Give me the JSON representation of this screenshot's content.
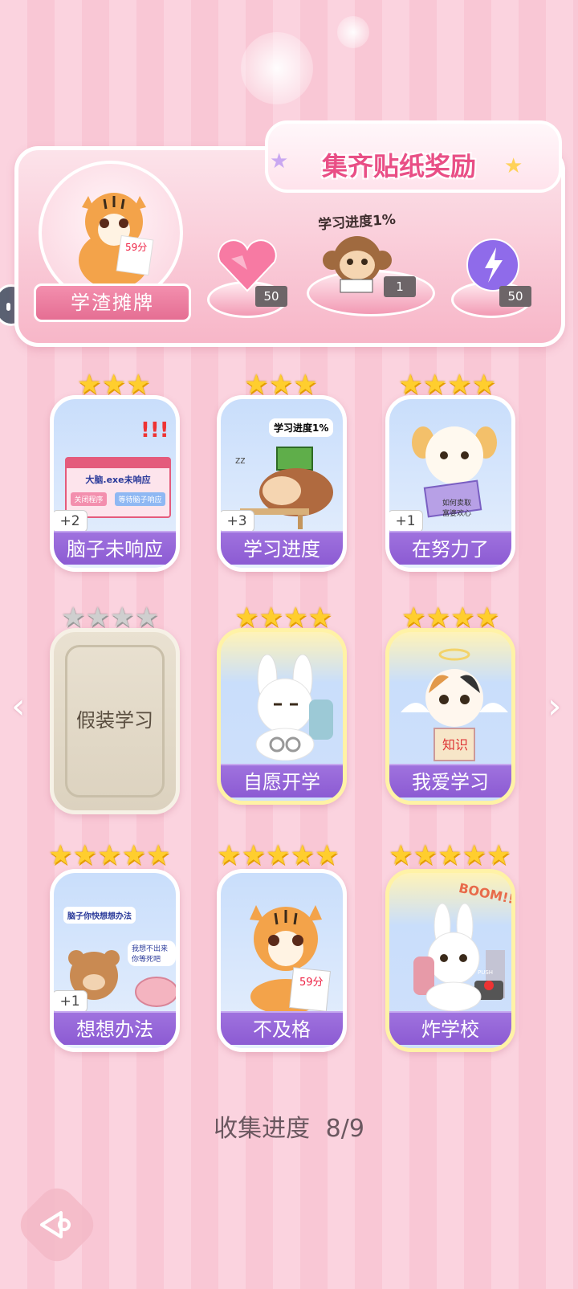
{
  "banner": {
    "title": "集齐贴纸奖励",
    "badge_label": "学渣摊牌",
    "mascot_paper": "59分",
    "progress_caption": "学习进度1%",
    "rewards": [
      {
        "icon": "pink-heart-gem-icon",
        "count": "50"
      },
      {
        "icon": "monkey-reading-icon",
        "count": "1"
      },
      {
        "icon": "purple-lightning-orb-icon",
        "count": "50"
      }
    ]
  },
  "cards": [
    {
      "label": "脑子未响应",
      "stars": 3,
      "plus": "+2",
      "art_text": "大脑.exe未响应",
      "btn1": "关闭程序",
      "btn2": "等待脑子响应"
    },
    {
      "label": "学习进度",
      "stars": 3,
      "plus": "+3",
      "art_text": "学习进度1%"
    },
    {
      "label": "在努力了",
      "stars": 4,
      "plus": "+1",
      "art_text": "如何卖取富婆欢心"
    },
    {
      "label": "假装学习",
      "stars": 4,
      "locked": true
    },
    {
      "label": "自愿开学",
      "stars": 4
    },
    {
      "label": "我爱学习",
      "stars": 4,
      "art_text": "知识"
    },
    {
      "label": "想想办法",
      "stars": 5,
      "plus": "+1",
      "art_text": "脑子你快想想办法",
      "art_text2": "我想不出来你等死吧"
    },
    {
      "label": "不及格",
      "stars": 5,
      "art_text": "59分"
    },
    {
      "label": "炸学校",
      "stars": 5,
      "art_text": "BOOM!!",
      "art_text2": "PUSH"
    }
  ],
  "collect": {
    "label": "收集进度",
    "value": "8/9"
  },
  "colors": {
    "accent": "#e94f86",
    "label_purple": "#8c5bd3",
    "star_gold": "#ffce2e"
  }
}
